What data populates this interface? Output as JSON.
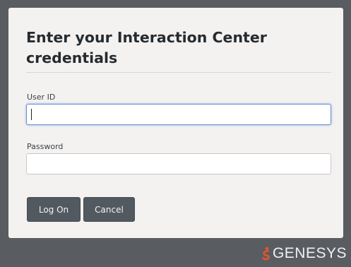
{
  "dialog": {
    "title": "Enter your Interaction Center credentials",
    "user_id": {
      "label": "User ID",
      "value": "",
      "placeholder": ""
    },
    "password": {
      "label": "Password",
      "value": "",
      "placeholder": ""
    },
    "buttons": {
      "logon_label": "Log On",
      "cancel_label": "Cancel"
    }
  },
  "footer": {
    "brand": "GENESYS",
    "logo_icon": "genesys-logo-icon"
  },
  "colors": {
    "background": "#595d61",
    "panel": "#f3f2f0",
    "button": "#525960",
    "brand_accent": "#e2542b"
  }
}
